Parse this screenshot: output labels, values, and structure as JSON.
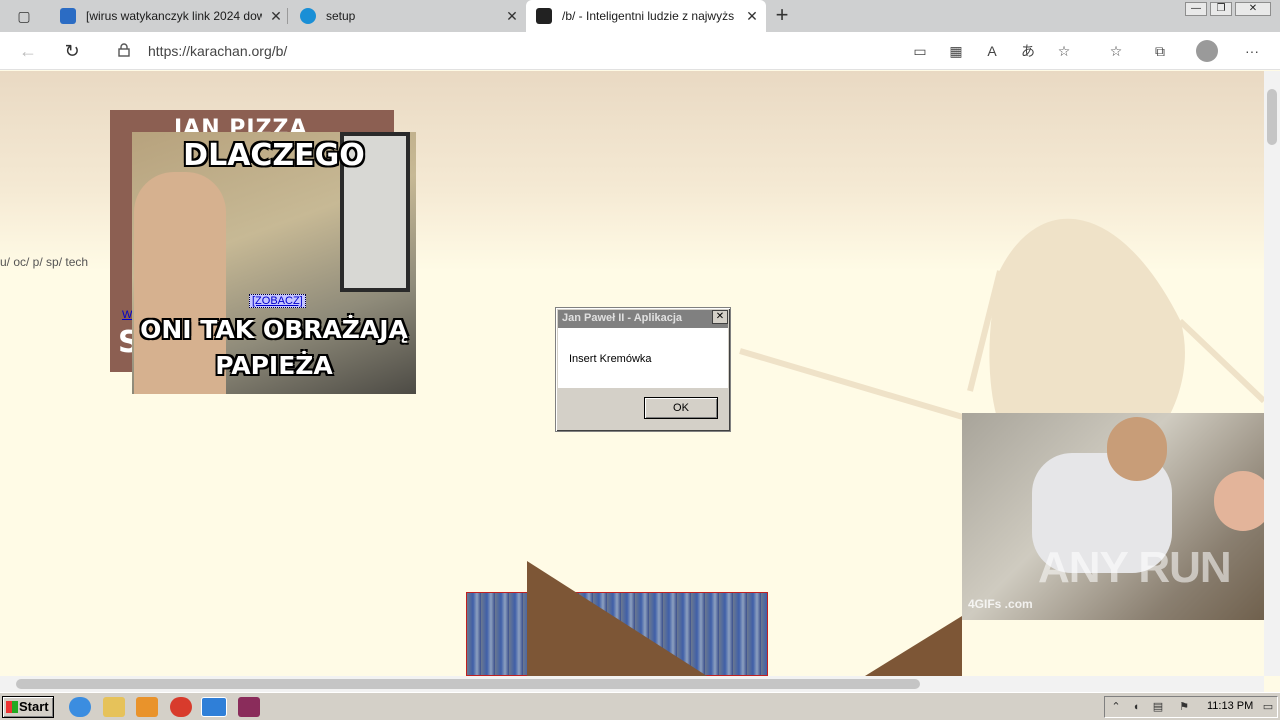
{
  "browser": {
    "tabs": [
      {
        "title": "[wirus watykanczyk link 2024 dow",
        "close": "✕",
        "favicon_color": "#2b6cc4"
      },
      {
        "title": "setup",
        "close": "✕",
        "favicon_color": "#1a8fd6"
      },
      {
        "title": "/b/ - Inteligentni ludzie z najwyżs",
        "close": "✕",
        "favicon_color": "#222222",
        "active": true
      }
    ],
    "new_tab": "+",
    "url": "https://karachan.org/b/",
    "window_controls": {
      "minimize": "—",
      "restore": "❐",
      "close": "✕"
    }
  },
  "page": {
    "board_nav": "u/  oc/  p/  sp/  tech",
    "meme_back": {
      "top_text": "JAN PIZZA DRUGI",
      "side_text": "S"
    },
    "meme_front": {
      "top_text": "DLACZEGO",
      "bottom_text": "ONI TAK OBRAŻAJĄ PAPIEŻA"
    },
    "zobacz_link": "[ZOBACZ]",
    "w_link": "W",
    "gif_watermark": "ANY RUN",
    "gif_credit": "4GIFs .com"
  },
  "dialog": {
    "title": "Jan Paweł II - Aplikacja",
    "message": "Insert Kremówka",
    "ok_label": "OK",
    "close": "✕"
  },
  "taskbar": {
    "start_label": "Start",
    "time": "11:13 PM"
  },
  "colors": {
    "accent_brown": "#7d5636",
    "page_bg": "#fffbe6",
    "dialog_title_bg": "#808080"
  }
}
